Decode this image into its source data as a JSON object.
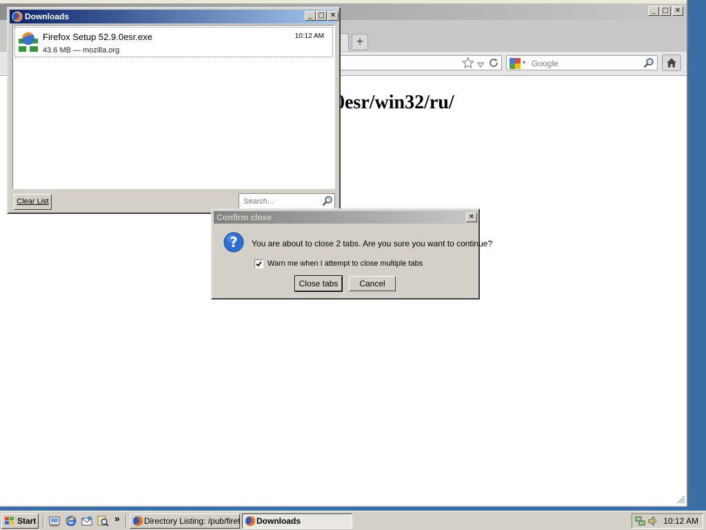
{
  "browser": {
    "search_placeholder": "Google",
    "page_heading": "0esr/win32/ru/",
    "new_tab_symbol": "+",
    "tab_close_symbol": "x"
  },
  "downloads": {
    "title": "Downloads",
    "item": {
      "filename": "Firefox Setup 52.9.0esr.exe",
      "status": "43.6 MB — mozilla.org",
      "time": "10:12 AM"
    },
    "clear_list_label": "Clear List",
    "search_placeholder": "Search..."
  },
  "confirm_dialog": {
    "title": "Confirm close",
    "message": "You are about to close 2 tabs. Are you sure you want to continue?",
    "checkbox_label": "Warn me when I attempt to close multiple tabs",
    "checkbox_checked": true,
    "close_tabs_label": "Close tabs",
    "cancel_label": "Cancel"
  },
  "taskbar": {
    "start_label": "Start",
    "overflow_symbol": "»",
    "tasks": [
      {
        "label": "Directory Listing: /pub/firef...",
        "active": false
      },
      {
        "label": "Downloads",
        "active": true
      }
    ],
    "clock": "10:12 AM"
  },
  "icons": [
    "firefox-icon",
    "installer-icon",
    "search-icon",
    "question-icon",
    "home-icon",
    "star-icon",
    "reload-icon",
    "windows-logo-icon"
  ]
}
